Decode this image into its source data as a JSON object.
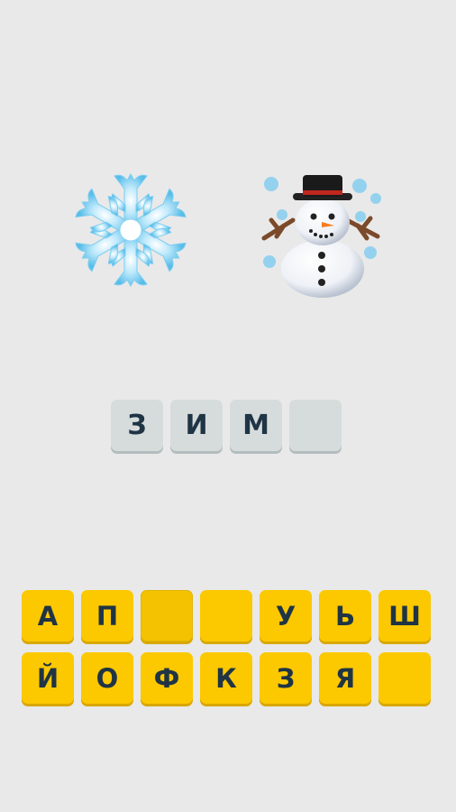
{
  "clue": {
    "emojis": [
      "snowflake-icon",
      "snowman-with-snow-icon"
    ]
  },
  "answer": {
    "slots": [
      "З",
      "И",
      "М",
      ""
    ]
  },
  "keyboard": {
    "rows": [
      [
        "А",
        "П",
        "",
        "",
        "У",
        "Ь",
        "Ш"
      ],
      [
        "Й",
        "О",
        "Ф",
        "К",
        "З",
        "Я",
        ""
      ]
    ]
  },
  "colors": {
    "background": "#e9e9e9",
    "key_yellow": "#fcc800",
    "answer_tile": "#d6dcdc",
    "letter_text": "#1f3444"
  }
}
